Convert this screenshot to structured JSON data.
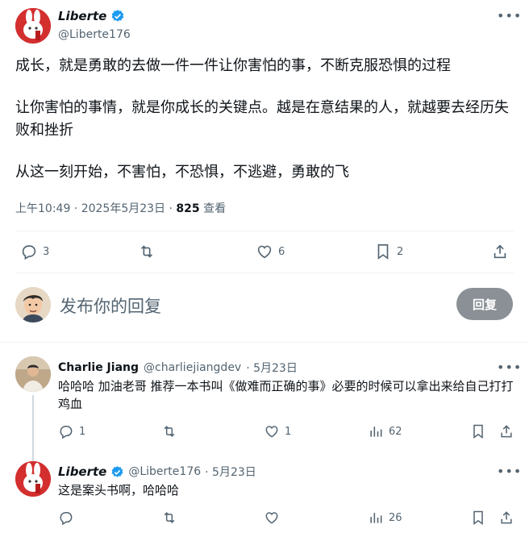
{
  "main_tweet": {
    "author_name": "Liberte",
    "author_handle": "@Liberte176",
    "paragraphs": [
      "成长，就是勇敢的去做一件一件让你害怕的事，不断克服恐惧的过程",
      "让你害怕的事情，就是你成长的关键点。越是在意结果的人，就越要去经历失败和挫折",
      "从这一刻开始，不害怕，不恐惧，不逃避，勇敢的飞"
    ],
    "timestamp": "上午10:49 · 2025年5月23日",
    "separator": " · ",
    "views_count": "825",
    "views_label": " 查看",
    "actions": {
      "replies": "3",
      "likes": "6",
      "bookmarks": "2"
    }
  },
  "compose": {
    "placeholder": "发布你的回复",
    "button_label": "回复"
  },
  "replies": [
    {
      "author_name": "Charlie Jiang",
      "author_handle": "@charliejiangdev",
      "date": "· 5月23日",
      "text": "哈哈哈 加油老哥 推荐一本书叫《做难而正确的事》必要的时候可以拿出来给自己打打鸡血",
      "replies": "1",
      "likes": "1",
      "views": "62"
    },
    {
      "author_name": "Liberte",
      "author_handle": "@Liberte176",
      "date": "· 5月23日",
      "text": "这是案头书啊，哈哈哈",
      "views": "26"
    }
  ],
  "colors": {
    "verified": "#1d9bf0",
    "muted": "#536471",
    "button": "#8b9096",
    "avatar_red": "#c62828"
  }
}
